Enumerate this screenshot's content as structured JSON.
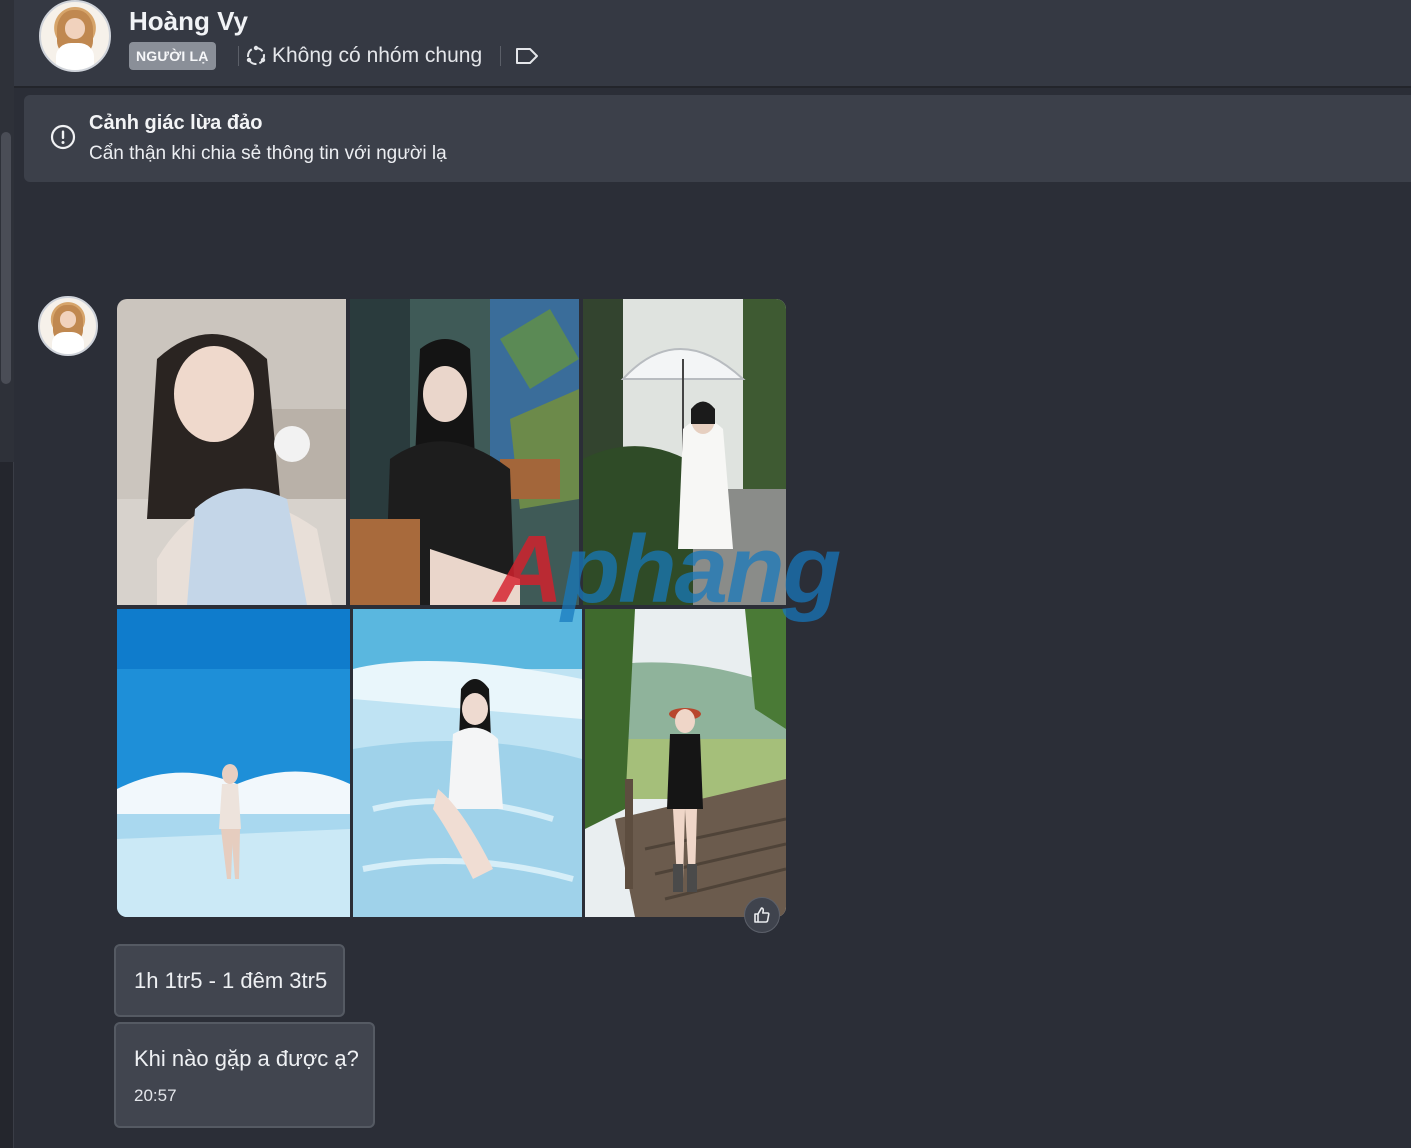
{
  "header": {
    "name": "Hoàng Vy",
    "badge": "NGƯỜI LẠ",
    "group_info": "Không có nhóm chung",
    "icons": {
      "group": "group-circle-icon",
      "tag": "tag-label-icon"
    }
  },
  "warning": {
    "title": "Cảnh giác lừa đảo",
    "text": "Cẩn thận khi chia sẻ thông tin với người lạ",
    "icon": "alert-circle-icon"
  },
  "gallery": {
    "photos": [
      {
        "scene": "indoor-portrait"
      },
      {
        "scene": "black-jacket-window"
      },
      {
        "scene": "umbrella-forest"
      },
      {
        "scene": "beach-blue-sky"
      },
      {
        "scene": "sitting-on-sand"
      },
      {
        "scene": "wooden-bridge-hill"
      }
    ],
    "reaction_icon": "thumbs-up-icon"
  },
  "watermark": {
    "first": "A",
    "rest": "phang"
  },
  "messages": [
    {
      "text": "1h 1tr5 - 1 đêm 3tr5"
    },
    {
      "text": "Khi nào gặp a được ạ?",
      "time": "20:57"
    }
  ],
  "colors": {
    "background": "#2b2e37",
    "header": "#353943",
    "warning": "#3c404a",
    "bubble": "#41454f",
    "badge": "#8a8f98"
  }
}
